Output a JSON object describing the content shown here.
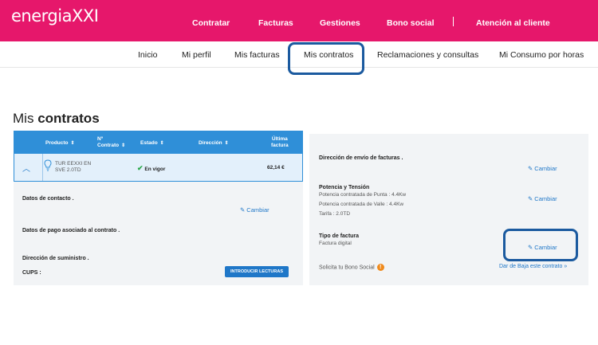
{
  "brand": {
    "logo": "energiaXXI"
  },
  "top_nav": [
    "Contratar",
    "Facturas",
    "Gestiones",
    "Bono social",
    "Atención al cliente"
  ],
  "sub_nav": [
    "Inicio",
    "Mi perfil",
    "Mis facturas",
    "Mis contratos",
    "Reclamaciones y consultas",
    "Mi Consumo por horas"
  ],
  "page": {
    "title_light": "Mis",
    "title_bold": "contratos"
  },
  "table": {
    "headers": {
      "producto": "Producto",
      "n_contrato_1": "Nº",
      "n_contrato_2": "Contrato",
      "estado": "Estado",
      "direccion": "Dirección",
      "ultima_1": "Última",
      "ultima_2": "factura"
    },
    "row": {
      "producto_1": "TUR EEXXI EN",
      "producto_2": "SVE 2.0TD",
      "estado": "En vigor",
      "importe": "62,14 €"
    }
  },
  "left_details": {
    "contacto": "Datos de contacto .",
    "cambiar": "Cambiar",
    "pago": "Datos de pago asociado al contrato .",
    "suministro": "Dirección de suministro .",
    "cups": "CUPS :",
    "button": "INTRODUCIR LECTURAS"
  },
  "right_details": {
    "envio": "Dirección de envío de facturas .",
    "cambiar": "Cambiar",
    "potencia_title": "Potencia y Tensión",
    "potencia_punta": "Potencia contratada de Punta : 4.4Kw",
    "potencia_valle": "Potencia contratada de Valle : 4.4Kw",
    "tarifa": "Tarifa : 2.0TD",
    "tipo_title": "Tipo de factura",
    "tipo_value": "Factura digital",
    "bono": "Solicita tu Bono Social",
    "baja": "Dar de Baja este contrato »"
  },
  "colors": {
    "brand": "#e6176b",
    "header_blue": "#2f8fd8",
    "link": "#1f77c8",
    "highlight": "#1b5a9f"
  }
}
